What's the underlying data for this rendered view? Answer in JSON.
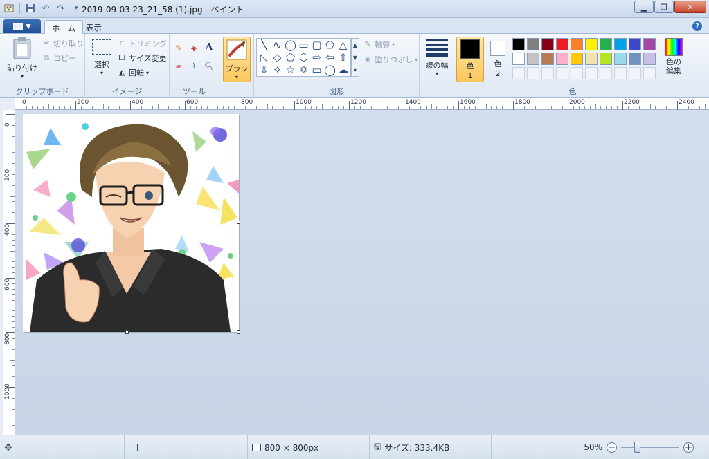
{
  "window": {
    "title": "2019-09-03 23_21_58 (1).jpg - ペイント",
    "minimize_icon": "minimize-icon",
    "maximize_icon": "maximize-icon",
    "close_icon": "close-icon"
  },
  "tabs": {
    "home": "ホーム",
    "view": "表示"
  },
  "ribbon": {
    "clipboard": {
      "label": "クリップボード",
      "paste": "貼り付け",
      "cut": "切り取り",
      "copy": "コピー"
    },
    "image": {
      "label": "イメージ",
      "select": "選択",
      "crop": "トリミング",
      "resize": "サイズ変更",
      "rotate": "回転"
    },
    "tools": {
      "label": "ツール"
    },
    "brush": {
      "label": "ブラシ"
    },
    "shapes": {
      "label": "図形",
      "outline": "輪郭",
      "fill": "塗りつぶし"
    },
    "size": {
      "label": "線の幅"
    },
    "colors": {
      "label": "色",
      "color1": "色",
      "color1_num": "1",
      "color2": "色",
      "color2_num": "2",
      "edit": "色の編集",
      "color1_value": "#000000",
      "color2_value": "#ffffff",
      "palette": [
        "#000000",
        "#7f7f7f",
        "#880015",
        "#ed1c24",
        "#ff7f27",
        "#fff200",
        "#22b14c",
        "#00a2e8",
        "#3f48cc",
        "#a349a4",
        "#ffffff",
        "#c3c3c3",
        "#b97a57",
        "#ffaec9",
        "#ffc90e",
        "#efe4b0",
        "#b5e61d",
        "#99d9ea",
        "#7092be",
        "#c8bfe7"
      ]
    }
  },
  "ruler": {
    "h": [
      "0",
      "200",
      "400",
      "600",
      "800",
      "1000",
      "1200",
      "1400",
      "1600",
      "1800",
      "2000",
      "2200",
      "2400"
    ],
    "v": [
      "0",
      "200",
      "400",
      "600",
      "800",
      "1000"
    ]
  },
  "status": {
    "dimensions": "800 × 800px",
    "size": "サイズ: 333.4KB",
    "zoom": "50%",
    "zoom_fraction": 0.5
  }
}
